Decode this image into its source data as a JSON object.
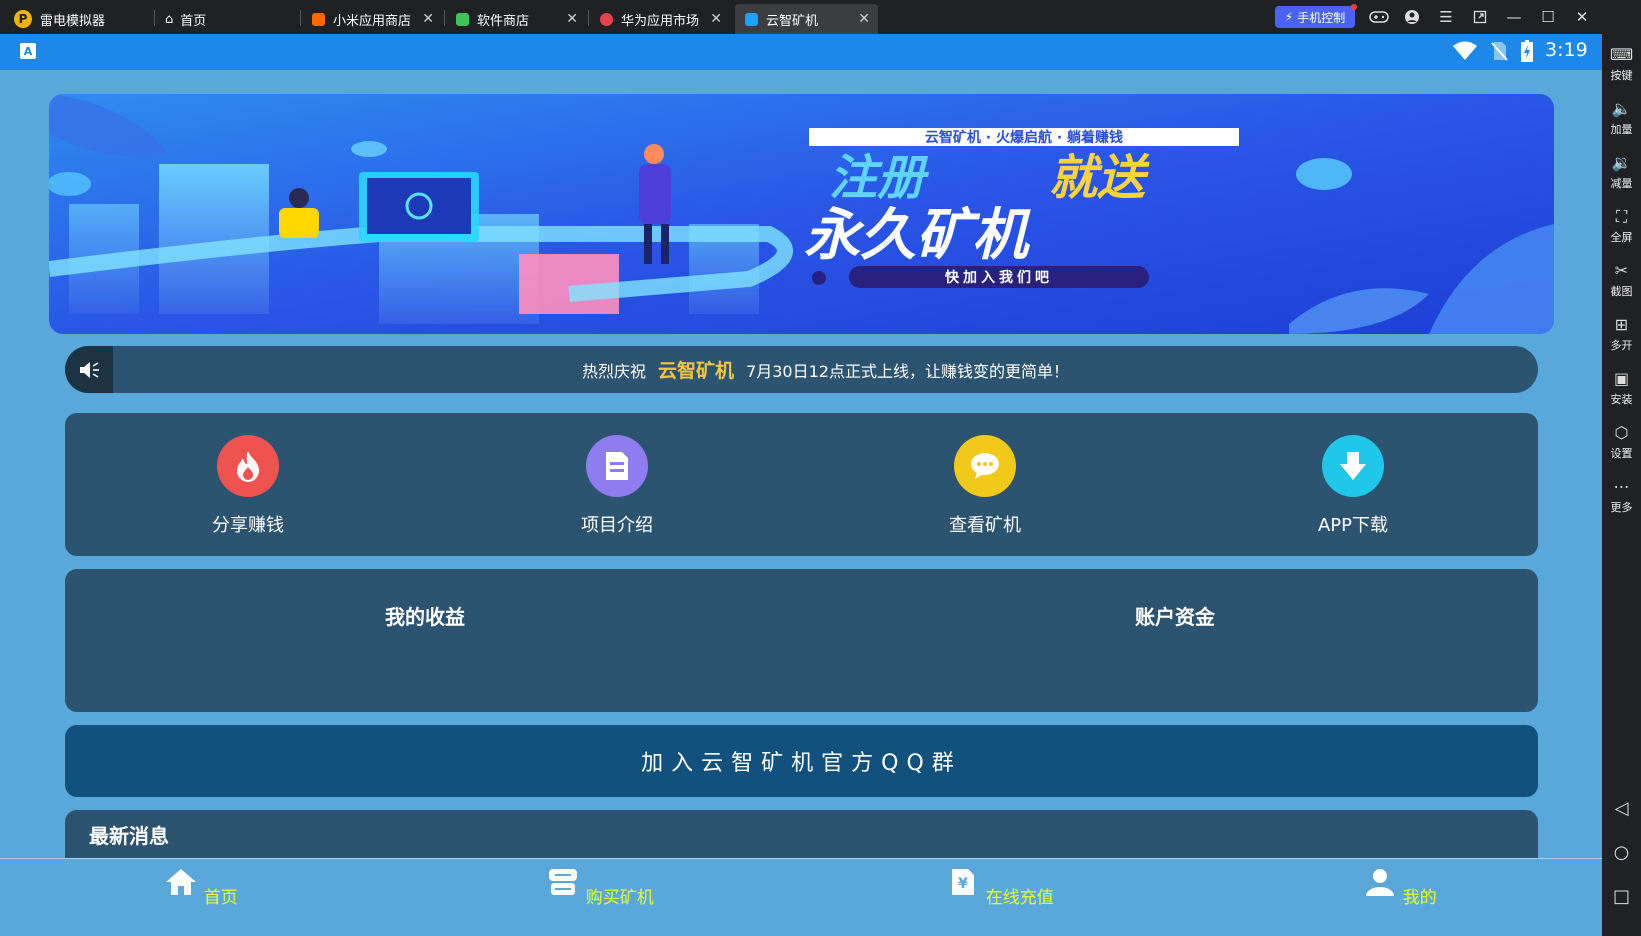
{
  "titlebar": {
    "app_name": "雷电模拟器",
    "tabs": [
      {
        "label": "首页",
        "color": "#ffffff"
      },
      {
        "label": "小米应用商店",
        "color": "#ff6900"
      },
      {
        "label": "软件商店",
        "color": "#3cc35b"
      },
      {
        "label": "华为应用市场",
        "color": "#e8414e"
      },
      {
        "label": "云智矿机",
        "color": "#1aa3ff",
        "active": true
      }
    ],
    "phone_control": "手机控制"
  },
  "sidebar": {
    "items": [
      {
        "label": "按键",
        "icon": "keyboard-icon"
      },
      {
        "label": "加量",
        "icon": "volume-up-icon"
      },
      {
        "label": "减量",
        "icon": "volume-down-icon"
      },
      {
        "label": "全屏",
        "icon": "fullscreen-icon"
      },
      {
        "label": "截图",
        "icon": "scissors-icon"
      },
      {
        "label": "多开",
        "icon": "multi-instance-icon"
      },
      {
        "label": "安装",
        "icon": "apk-install-icon"
      },
      {
        "label": "设置",
        "icon": "settings-icon"
      },
      {
        "label": "更多",
        "icon": "more-icon"
      }
    ]
  },
  "statusbar": {
    "time": "3:19"
  },
  "banner": {
    "tagline": "云智矿机 · 火爆启航 · 躺着赚钱",
    "headline_part1": "注册",
    "headline_part2": "就送",
    "headline_line2": "永久矿机",
    "cta": "快加入我们吧"
  },
  "notice": {
    "prefix": "热烈庆祝",
    "brand": "云智矿机",
    "suffix": "7月30日12点正式上线，让赚钱变的更简单！"
  },
  "menu": [
    {
      "label": "分享赚钱",
      "icon": "flame-icon",
      "color": "#ef5350"
    },
    {
      "label": "项目介绍",
      "icon": "document-icon",
      "color": "#8e7cf0"
    },
    {
      "label": "查看矿机",
      "icon": "chat-bubble-icon",
      "color": "#f2c81b"
    },
    {
      "label": "APP下载",
      "icon": "download-icon",
      "color": "#21c7e8"
    }
  ],
  "income": {
    "my_earnings": "我的收益",
    "account_funds": "账户资金"
  },
  "qq_button": "加入云智矿机官方QQ群",
  "news": {
    "title": "最新消息"
  },
  "bottom_nav": [
    {
      "label": "首页",
      "icon": "home-icon"
    },
    {
      "label": "购买矿机",
      "icon": "shop-icon"
    },
    {
      "label": "在线充值",
      "icon": "recharge-icon"
    },
    {
      "label": "我的",
      "icon": "user-icon"
    }
  ],
  "colors": {
    "accent": "#1d88e8",
    "screen_bg": "#5aa7da",
    "card": "#2c5470",
    "nav_text": "#e8ff2c",
    "brand_gold": "#f6c544"
  }
}
